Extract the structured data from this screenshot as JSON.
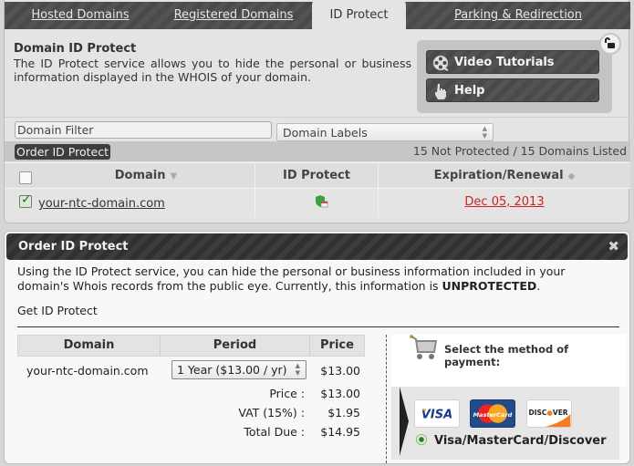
{
  "tabs": [
    {
      "label": "Hosted Domains",
      "active": false
    },
    {
      "label": "Registered Domains",
      "active": false
    },
    {
      "label": "ID Protect",
      "active": true
    },
    {
      "label": "Parking & Redirection",
      "active": false
    }
  ],
  "intro": {
    "title": "Domain ID Protect",
    "text": "The ID Protect service allows you to hide the personal or business information displayed in the WHOIS of your domain."
  },
  "help_box": {
    "video_tutorials": "Video Tutorials",
    "help": "Help"
  },
  "filters": {
    "domain_filter_value": "Domain Filter",
    "domain_labels_selected": "Domain Labels"
  },
  "actions": {
    "order_button": "Order ID Protect",
    "listing_count": "15 Not Protected / 15 Domains Listed"
  },
  "domain_table": {
    "columns": [
      "Domain",
      "ID Protect",
      "Expiration/Renewal"
    ],
    "rows": [
      {
        "checked": true,
        "domain": "your-ntc-domain.com",
        "id_protect_icon": "shield-add-icon",
        "expiration": "Dec 05, 2013"
      }
    ]
  },
  "order_panel": {
    "title": "Order ID Protect",
    "close": "✖",
    "description_prefix": "Using the ID Protect service, you can hide the personal or business information included in your domain's Whois records from the public eye. Currently, this information is ",
    "status": "UNPROTECTED",
    "description_suffix": ".",
    "get_label": "Get ID Protect",
    "price_table": {
      "columns": [
        "Domain",
        "Period",
        "Price"
      ],
      "row": {
        "domain": "your-ntc-domain.com",
        "period": "1 Year ($13.00 / yr)",
        "price": "$13.00"
      }
    },
    "summary": {
      "price_label": "Price :",
      "price": "$13.00",
      "vat_label": "VAT (15%) :",
      "vat": "$1.95",
      "total_label": "Total Due :",
      "total": "$14.95"
    },
    "payment": {
      "title": "Select the method of payment:",
      "cards": [
        "VISA",
        "MasterCard",
        "DISCOVER"
      ],
      "option": "Visa/MasterCard/Discover"
    }
  },
  "colors": {
    "expiry_red": "#cc2222",
    "tab_bar": "#4a4a4a",
    "header_dark": "#303030"
  }
}
